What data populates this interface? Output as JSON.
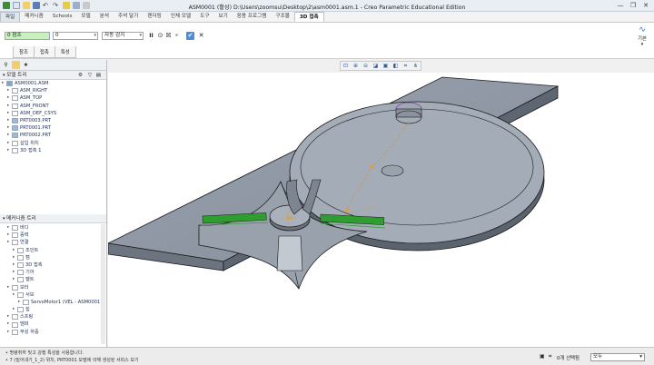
{
  "titlebar": {
    "title": "ASM0001 (활성) D:\\Users\\zoomsu\\Desktop\\2\\asm0001.asm.1 - Creo Parametric Educational Edition",
    "minimize": "—",
    "maximize": "❐",
    "close": "✕"
  },
  "menu": {
    "tabs": [
      "파일",
      "메커니즘",
      "Schools",
      "모델",
      "분석",
      "주석 달기",
      "렌더링",
      "인체 모델",
      "도구",
      "보기",
      "응용 프로그램",
      "구조물",
      "3D 접촉"
    ]
  },
  "ribbon": {
    "reference_value": "0 참조",
    "option_value": "0",
    "mode_value": "자동 감지",
    "pause": "II",
    "ok": "✔",
    "cancel": "✕",
    "right_label": "기본",
    "subtabs": [
      "참조",
      "접촉",
      "특성"
    ]
  },
  "leftpanel": {
    "model_tree_title": "모델 트리",
    "model_tree_items": [
      {
        "label": "ASM0001.ASM",
        "icon": "assembly-icon",
        "level": 0
      },
      {
        "label": "ASM_RIGHT",
        "icon": "datum-plane-icon",
        "level": 1
      },
      {
        "label": "ASM_TOP",
        "icon": "datum-plane-icon",
        "level": 1
      },
      {
        "label": "ASM_FRONT",
        "icon": "datum-plane-icon",
        "level": 1
      },
      {
        "label": "ASM_DEF_CSYS",
        "icon": "csys-icon",
        "level": 1
      },
      {
        "label": "PRT0003.PRT",
        "icon": "part-icon",
        "level": 1
      },
      {
        "label": "PRT0001.PRT",
        "icon": "part-icon",
        "level": 1
      },
      {
        "label": "PRT0002.PRT",
        "icon": "part-icon",
        "level": 1
      },
      {
        "label": "삽입 위치",
        "icon": "insert-icon",
        "level": 1
      },
      {
        "label": "3D 접촉 1",
        "icon": "contact-icon",
        "level": 1
      }
    ],
    "mech_tree_title": "메커니즘 트리",
    "mech_tree_items": [
      {
        "label": "바디",
        "level": 1
      },
      {
        "label": "중력",
        "level": 1
      },
      {
        "label": "연결",
        "level": 1
      },
      {
        "label": "조인트",
        "level": 2
      },
      {
        "label": "캠",
        "level": 2
      },
      {
        "label": "3D 접촉",
        "level": 2
      },
      {
        "label": "기어",
        "level": 2
      },
      {
        "label": "벨트",
        "level": 2
      },
      {
        "label": "모터",
        "level": 1
      },
      {
        "label": "서보",
        "level": 2
      },
      {
        "label": "ServoMotor1 (VEL - ASM0001)",
        "level": 3
      },
      {
        "label": "힘",
        "level": 2
      },
      {
        "label": "스프링",
        "level": 1
      },
      {
        "label": "댐퍼",
        "level": 1
      },
      {
        "label": "부싱 하중",
        "level": 1
      }
    ]
  },
  "statusbar": {
    "message1": "• 명령취하 및고 강행 특성을 사용합니다.",
    "message2": "• 7 (밀어내기_1_2) 위치, PRT0001 모델에 의해 생성된 서피스 보기",
    "selection_count": "0개 선택됨",
    "filter_value": "모두"
  },
  "colors": {
    "plate": "#8d96a3",
    "edge": "#1a1a1a",
    "highlight_green": "#2f9d2f",
    "accent_blue": "#2a5a9a"
  }
}
